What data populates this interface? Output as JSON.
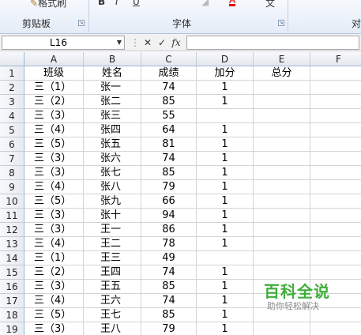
{
  "ribbon": {
    "format_painter_label": "格式刷",
    "clipboard_label": "剪贴板",
    "font_label": "字体",
    "align_partial_label": "对",
    "bold_glyph": "B",
    "italic_glyph": "I",
    "underline_glyph": "U",
    "font_color_glyph": "A",
    "wrap_glyph": "文"
  },
  "formula_bar": {
    "name_box": "L16",
    "cancel_glyph": "✕",
    "enter_glyph": "✓",
    "fx_glyph": "fx",
    "value": ""
  },
  "columns": [
    "A",
    "B",
    "C",
    "D",
    "E",
    "F"
  ],
  "row_numbers": [
    "1",
    "2",
    "3",
    "4",
    "5",
    "6",
    "7",
    "8",
    "9",
    "10",
    "11",
    "12",
    "13",
    "14",
    "15",
    "16",
    "17",
    "18",
    "19"
  ],
  "sheet": {
    "header": {
      "a": "班级",
      "b": "姓名",
      "c": "成绩",
      "d": "加分",
      "e": "总分",
      "f": ""
    },
    "rows": [
      {
        "a": "三（1）",
        "b": "张一",
        "c": "74",
        "d": "1"
      },
      {
        "a": "三（2）",
        "b": "张二",
        "c": "85",
        "d": "1"
      },
      {
        "a": "三（3）",
        "b": "张三",
        "c": "55",
        "d": ""
      },
      {
        "a": "三（4）",
        "b": "张四",
        "c": "64",
        "d": "1"
      },
      {
        "a": "三（5）",
        "b": "张五",
        "c": "81",
        "d": "1"
      },
      {
        "a": "三（3）",
        "b": "张六",
        "c": "74",
        "d": "1"
      },
      {
        "a": "三（3）",
        "b": "张七",
        "c": "85",
        "d": "1"
      },
      {
        "a": "三（4）",
        "b": "张八",
        "c": "79",
        "d": "1"
      },
      {
        "a": "三（5）",
        "b": "张九",
        "c": "66",
        "d": "1"
      },
      {
        "a": "三（3）",
        "b": "张十",
        "c": "94",
        "d": "1"
      },
      {
        "a": "三（3）",
        "b": "王一",
        "c": "86",
        "d": "1"
      },
      {
        "a": "三（4）",
        "b": "王二",
        "c": "78",
        "d": "1"
      },
      {
        "a": "三（1）",
        "b": "王三",
        "c": "49",
        "d": ""
      },
      {
        "a": "三（2）",
        "b": "王四",
        "c": "74",
        "d": "1"
      },
      {
        "a": "三（3）",
        "b": "王五",
        "c": "85",
        "d": "1"
      },
      {
        "a": "三（4）",
        "b": "王六",
        "c": "74",
        "d": "1"
      },
      {
        "a": "三（5）",
        "b": "王七",
        "c": "85",
        "d": "1"
      },
      {
        "a": "三（3）",
        "b": "王八",
        "c": "79",
        "d": "1"
      }
    ]
  },
  "watermark": {
    "title": "百科全说",
    "subtitle": "助你轻松解决"
  },
  "colors": {
    "grid_line": "#d4d4d4",
    "header_border": "#9eb6ce",
    "watermark_green": "#3fae3a"
  }
}
